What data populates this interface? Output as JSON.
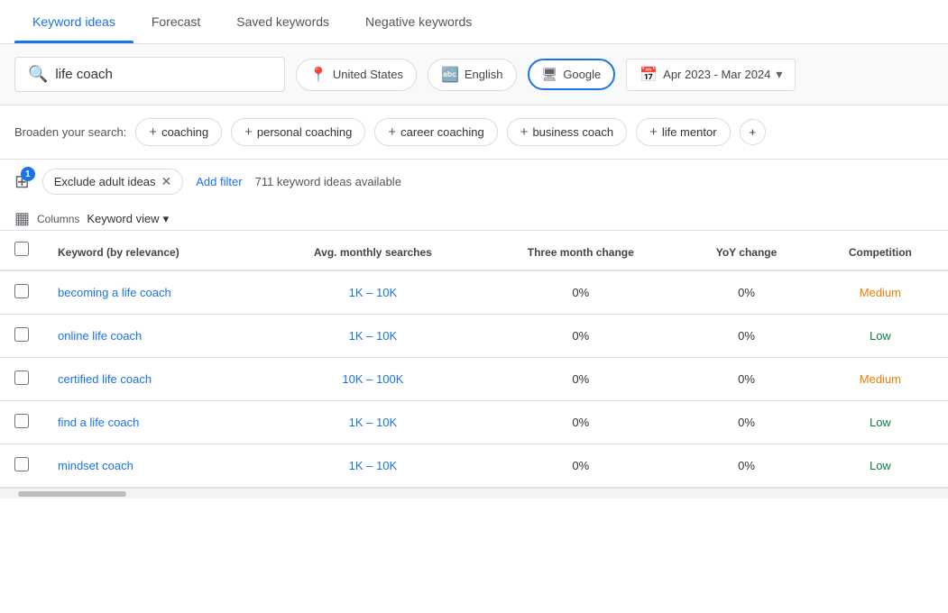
{
  "tabs": [
    {
      "label": "Keyword ideas",
      "active": true
    },
    {
      "label": "Forecast",
      "active": false
    },
    {
      "label": "Saved keywords",
      "active": false
    },
    {
      "label": "Negative keywords",
      "active": false
    }
  ],
  "search": {
    "value": "life coach",
    "placeholder": "life coach"
  },
  "filters": {
    "location": "United States",
    "language": "English",
    "platform": "Google",
    "date_range": "Apr 2023 - Mar 2024"
  },
  "broaden": {
    "label": "Broaden your search:",
    "tags": [
      "coaching",
      "personal coaching",
      "career coaching",
      "business coach",
      "life mentor"
    ]
  },
  "toolbar": {
    "filter_badge": "1",
    "exclude_label": "Exclude adult ideas",
    "add_filter_label": "Add filter",
    "ideas_count": "711 keyword ideas available"
  },
  "columns_row": {
    "columns_label": "Columns",
    "keyword_view_label": "Keyword view"
  },
  "table": {
    "headers": [
      {
        "label": "",
        "key": "checkbox"
      },
      {
        "label": "Keyword (by relevance)",
        "key": "keyword"
      },
      {
        "label": "Avg. monthly searches",
        "key": "avg_monthly"
      },
      {
        "label": "Three month change",
        "key": "three_month"
      },
      {
        "label": "YoY change",
        "key": "yoy"
      },
      {
        "label": "Competition",
        "key": "competition"
      }
    ],
    "rows": [
      {
        "keyword": "becoming a life coach",
        "avg_monthly": "1K – 10K",
        "three_month": "0%",
        "yoy": "0%",
        "competition": "Medium",
        "competition_level": "medium"
      },
      {
        "keyword": "online life coach",
        "avg_monthly": "1K – 10K",
        "three_month": "0%",
        "yoy": "0%",
        "competition": "Low",
        "competition_level": "low"
      },
      {
        "keyword": "certified life coach",
        "avg_monthly": "10K – 100K",
        "three_month": "0%",
        "yoy": "0%",
        "competition": "Medium",
        "competition_level": "medium"
      },
      {
        "keyword": "find a life coach",
        "avg_monthly": "1K – 10K",
        "three_month": "0%",
        "yoy": "0%",
        "competition": "Low",
        "competition_level": "low"
      },
      {
        "keyword": "mindset coach",
        "avg_monthly": "1K – 10K",
        "three_month": "0%",
        "yoy": "0%",
        "competition": "Low",
        "competition_level": "low"
      }
    ]
  },
  "colors": {
    "blue": "#1a73e8",
    "green": "#0b8043",
    "orange": "#f57c00"
  }
}
